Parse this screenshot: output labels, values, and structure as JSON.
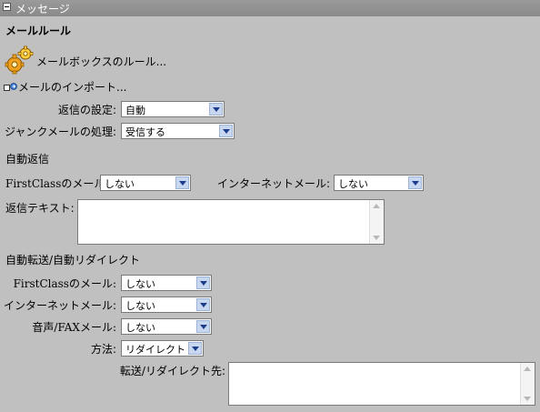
{
  "header": {
    "title": "メッセージ"
  },
  "mail_rules": {
    "title": "メールルール",
    "mailbox_rules_link": "メールボックスのルール...",
    "import_mail_link": "メールのインポート..."
  },
  "reply_setting": {
    "label": "返信の設定:",
    "value": "自動"
  },
  "junk_mail": {
    "label": "ジャンクメールの処理:",
    "value": "受信する"
  },
  "auto_reply": {
    "title": "自動返信",
    "firstclass_label": "FirstClassのメール:",
    "firstclass_value": "しない",
    "internet_label": "インターネットメール:",
    "internet_value": "しない",
    "text_label": "返信テキスト:",
    "text_value": ""
  },
  "auto_forward": {
    "title": "自動転送/自動リダイレクト",
    "firstclass_label": "FirstClassのメール:",
    "firstclass_value": "しない",
    "internet_label": "インターネットメール:",
    "internet_value": "しない",
    "voice_fax_label": "音声/FAXメール:",
    "voice_fax_value": "しない",
    "method_label": "方法:",
    "method_value": "リダイレクト",
    "destination_label": "転送/リダイレクト先:",
    "destination_value": ""
  },
  "icons": {
    "collapse": "collapse-minus-icon",
    "gears": "gears-icon",
    "import": "import-mail-icon",
    "dropdown": "chevron-down-icon"
  },
  "colors": {
    "background": "#c0c0c0",
    "header": "#8e8e8e",
    "dropdown_arrow_bg": "#c8d7f0",
    "dropdown_arrow": "#1e3c8c"
  }
}
